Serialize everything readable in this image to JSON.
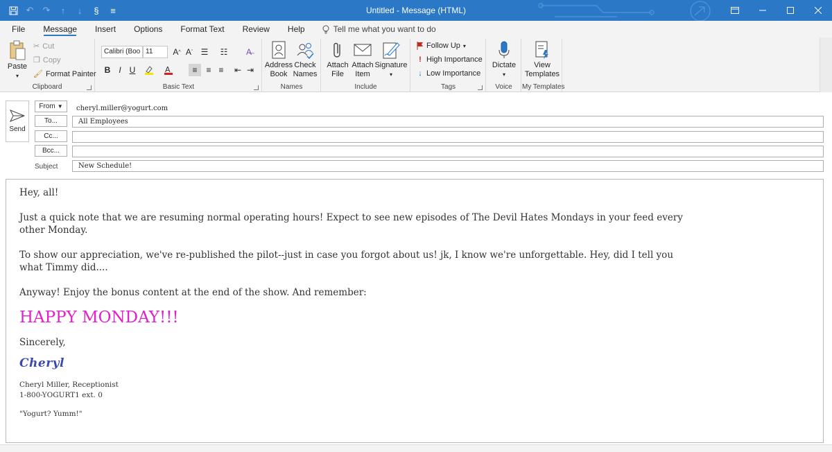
{
  "window": {
    "title": "Untitled  -  Message (HTML)"
  },
  "tabs": [
    {
      "label": "File"
    },
    {
      "label": "Message"
    },
    {
      "label": "Insert"
    },
    {
      "label": "Options"
    },
    {
      "label": "Format Text"
    },
    {
      "label": "Review"
    },
    {
      "label": "Help"
    }
  ],
  "tellme": "Tell me what you want to do",
  "ribbon": {
    "clipboard": {
      "label": "Clipboard",
      "paste": "Paste",
      "cut": "Cut",
      "copy": "Copy",
      "format_painter": "Format Painter"
    },
    "basic_text": {
      "label": "Basic Text",
      "font_name": "Calibri (Boo",
      "font_size": "11",
      "bold": "B",
      "italic": "I",
      "underline": "U"
    },
    "names": {
      "label": "Names",
      "address_book": "Address Book",
      "check_names": "Check Names"
    },
    "include": {
      "label": "Include",
      "attach_file": "Attach File",
      "attach_item": "Attach Item",
      "signature": "Signature"
    },
    "tags": {
      "label": "Tags",
      "follow_up": "Follow Up",
      "high_importance": "High Importance",
      "low_importance": "Low Importance"
    },
    "voice": {
      "label": "Voice",
      "dictate": "Dictate"
    },
    "templates": {
      "label": "My Templates",
      "view_templates": "View Templates"
    }
  },
  "header": {
    "send_label": "Send",
    "from_label": "From",
    "from_value": "cheryl.miller@yogurt.com",
    "to_label": "To...",
    "to_value": "All Employees",
    "cc_label": "Cc...",
    "cc_value": "",
    "bcc_label": "Bcc...",
    "bcc_value": "",
    "subject_label": "Subject",
    "subject_value": "New Schedule!"
  },
  "message": {
    "greeting": "Hey, all!",
    "p1": "Just a quick note that we are resuming normal operating hours! Expect to see new episodes of The Devil Hates Mondays in your feed every other Monday.",
    "p2": "To show our appreciation, we've re-published the pilot--just in case you forgot about us! jk, I know we're unforgettable. Hey, did I tell you what Timmy did....",
    "p3": "Anyway! Enjoy the bonus content at the end of the show. And remember:",
    "happy": "HAPPY MONDAY!!!",
    "happy_color": "#e020c8",
    "closing": "Sincerely,",
    "signature": "Cheryl",
    "sig_name": "Cheryl Miller, Receptionist",
    "sig_phone": "1-800-YOGURT1 ext. 0",
    "sig_quote": "\"Yogurt? Yumm!\""
  },
  "colors": {
    "titlebar": "#2b78c6",
    "ribbon": "#f3f3f3",
    "signature": "#3c4aa8"
  }
}
